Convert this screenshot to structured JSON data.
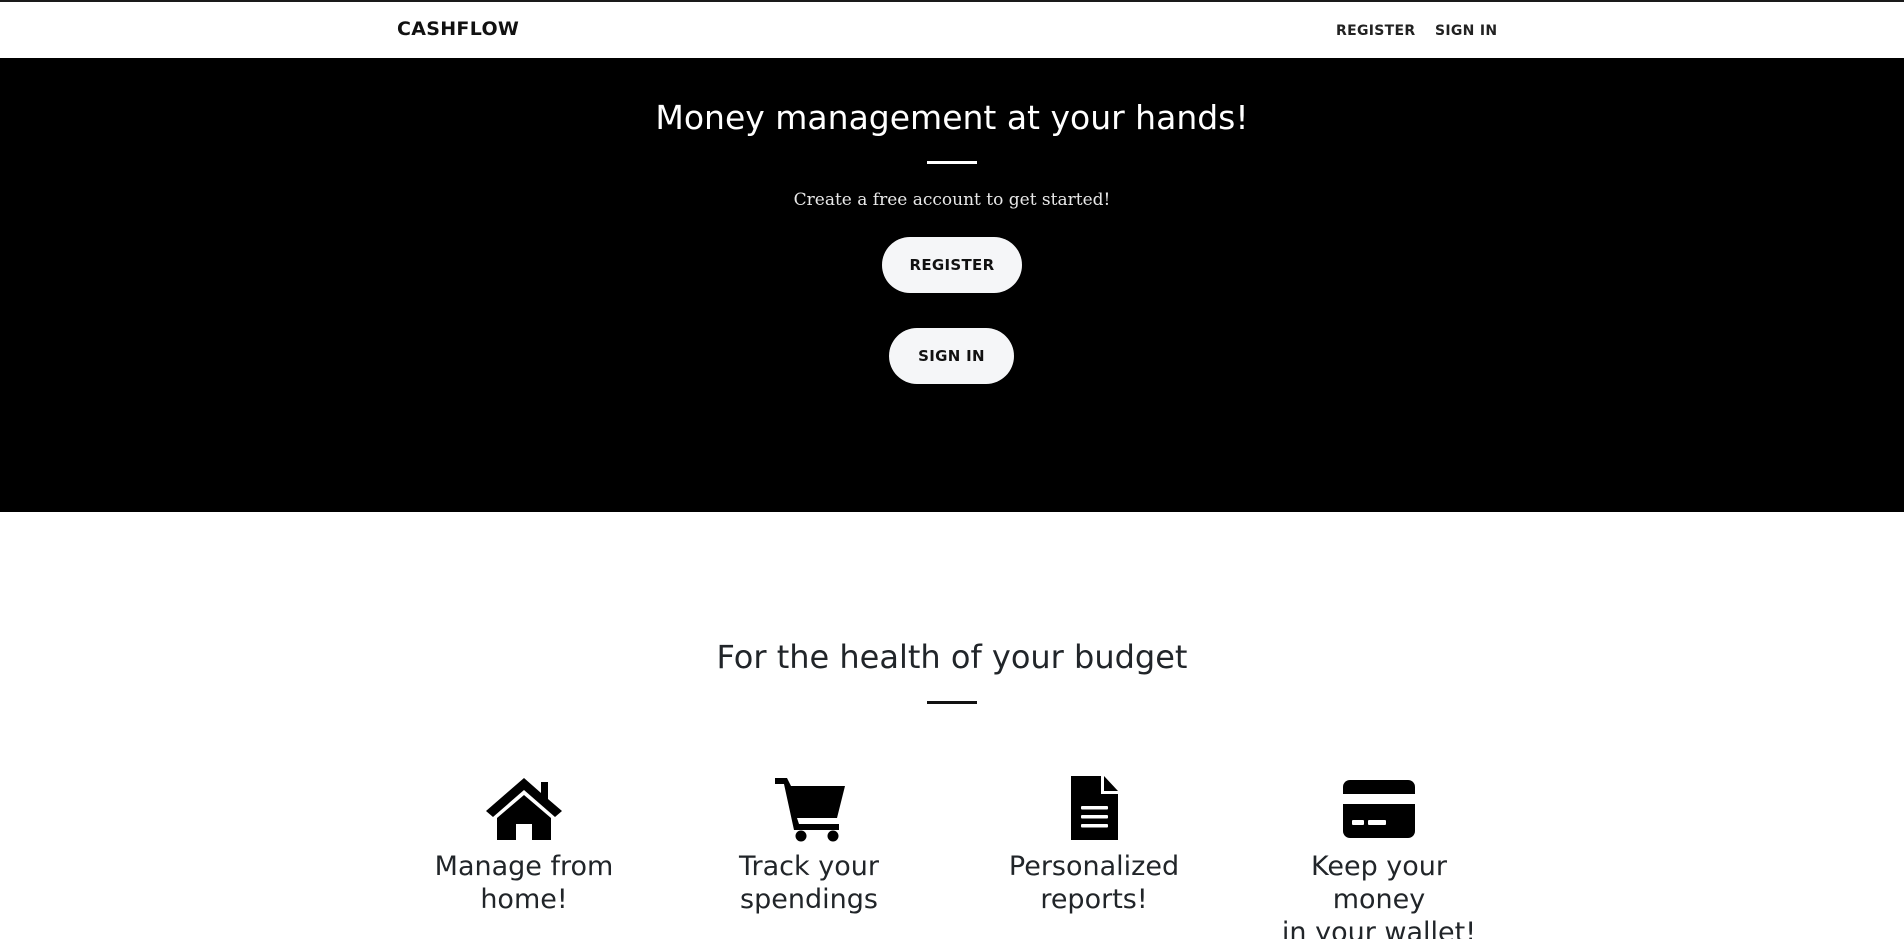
{
  "navbar": {
    "brand": "CASHFLOW",
    "links": {
      "register": "REGISTER",
      "signin": "SIGN IN"
    }
  },
  "hero": {
    "title": "Money management at your hands!",
    "subtitle": "Create a free account to get started!",
    "register_label": "REGISTER",
    "signin_label": "SIGN IN"
  },
  "features": {
    "title": "For the health of your budget",
    "items": [
      {
        "icon": "home-icon",
        "line1": "Manage from",
        "line2": "home!"
      },
      {
        "icon": "shopping-cart-icon",
        "line1": "Track your",
        "line2": "spendings"
      },
      {
        "icon": "document-icon",
        "line1": "Personalized",
        "line2": "reports!"
      },
      {
        "icon": "credit-card-icon",
        "line1": "Keep your money",
        "line2": "in your wallet!"
      }
    ]
  },
  "colors": {
    "hero_background": "#000000",
    "page_background": "#ffffff",
    "button_background": "#f5f6f8",
    "text_dark": "#212529"
  }
}
